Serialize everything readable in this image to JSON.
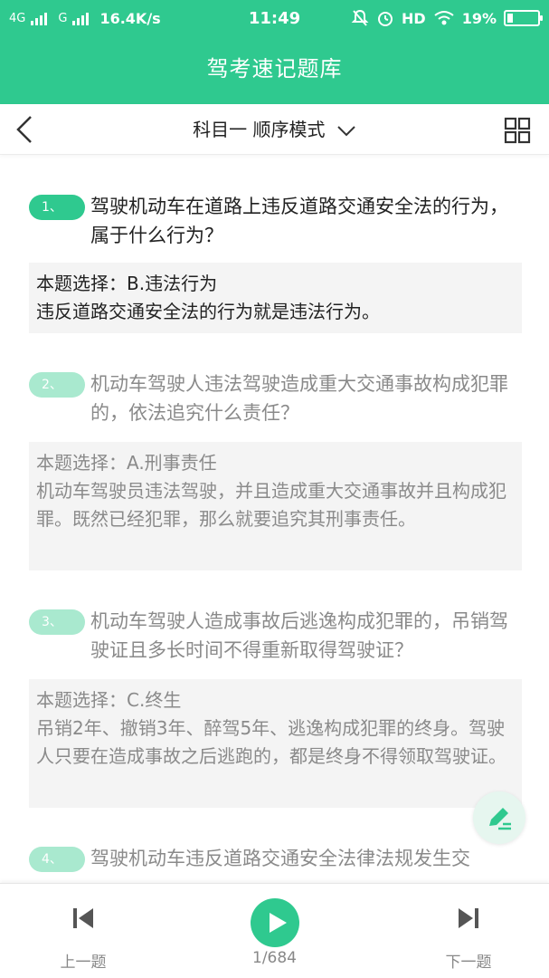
{
  "status_bar": {
    "net1": "4G",
    "net2": "G",
    "speed": "16.4K/s",
    "time": "11:49",
    "hd": "HD",
    "battery": "19%",
    "battery_level": 0.19
  },
  "app": {
    "title": "驾考速记题库"
  },
  "toolbar": {
    "mode_label": "科目一 顺序模式"
  },
  "questions": [
    {
      "num": "1、",
      "text": "驾驶机动车在道路上违反道路交通安全法的行为，属于什么行为？",
      "answer": "本题选择：B.违法行为",
      "explanation": "违反道路交通安全法的行为就是违法行为。"
    },
    {
      "num": "2、",
      "text": "机动车驾驶人违法驾驶造成重大交通事故构成犯罪的，依法追究什么责任？",
      "answer": "本题选择：A.刑事责任",
      "explanation": "机动车驾驶员违法驾驶，并且造成重大交通事故并且构成犯罪。既然已经犯罪，那么就要追究其刑事责任。"
    },
    {
      "num": "3、",
      "text": "机动车驾驶人造成事故后逃逸构成犯罪的，吊销驾驶证且多长时间不得重新取得驾驶证？",
      "answer": "本题选择：C.终生",
      "explanation": "吊销2年、撤销3年、醉驾5年、逃逸构成犯罪的终身。驾驶人只要在造成事故之后逃跑的，都是终身不得领取驾驶证。"
    },
    {
      "num": "4、",
      "text": "驾驶机动车违反道路交通安全法律法规发生交"
    }
  ],
  "bottom_nav": {
    "prev_label": "上一题",
    "page_count": "1/684",
    "next_label": "下一题"
  },
  "icons": {
    "back": "chevron-left-icon",
    "mode": "chevron-down-icon",
    "grid": "grid-icon",
    "edit": "pen-icon",
    "prev": "skip-previous-icon",
    "play": "play-icon",
    "next": "skip-next-icon"
  },
  "colors": {
    "accent": "#2fc98f",
    "accent_light": "#a9e9cf"
  }
}
